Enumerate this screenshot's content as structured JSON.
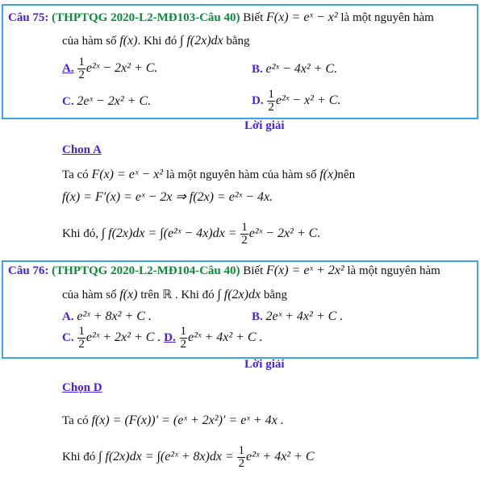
{
  "q75": {
    "label": "Câu 75:",
    "source": "(THPTQG 2020-L2-MĐ103-Câu 40)",
    "stem1_a": "Biết",
    "stem1_math": "F(x) = eˣ − x²",
    "stem1_b": "là một nguyên hàm",
    "stem2_a": "của hàm số",
    "stem2_math1": "f(x)",
    "stem2_b": ". Khi đó",
    "stem2_math2": "∫ f(2x)dx",
    "stem2_c": "bằng",
    "options": [
      {
        "label": "A.",
        "num": "1",
        "den": "2",
        "expr": "e²ˣ − 2x² + C."
      },
      {
        "label": "B.",
        "expr": "e²ˣ − 4x² + C."
      },
      {
        "label": "C.",
        "expr": "2eˣ − 2x² + C."
      },
      {
        "label": "D.",
        "num": "1",
        "den": "2",
        "expr": "e²ˣ − x² + C."
      }
    ],
    "solution_title": "Lời giải",
    "answer": "Chon A",
    "s1_a": "Ta có",
    "s1_math": "F(x) = eˣ − x²",
    "s1_b": "là một nguyên hàm của hàm số",
    "s1_math2": "f(x)",
    "s1_c": "nên",
    "s2_math": "f(x) = F′(x) = eˣ − 2x ⇒ f(2x) = e²ˣ − 4x.",
    "s3_a": "Khi đó,",
    "s3_math": "∫ f(2x)dx = ∫(e²ˣ − 4x)dx =",
    "s3_num": "1",
    "s3_den": "2",
    "s3_rest": "e²ˣ − 2x² + C."
  },
  "q76": {
    "label": "Câu 76:",
    "source": "(THPTQG 2020-L2-MĐ104-Câu 40)",
    "stem1_a": "Biết",
    "stem1_math": "F(x) = eˣ + 2x²",
    "stem1_b": "là một nguyên hàm",
    "stem2_a": "của hàm số",
    "stem2_math1": "f(x)",
    "stem2_b": "trên ℝ . Khi đó",
    "stem2_math2": "∫ f(2x)dx",
    "stem2_c": "bằng",
    "options": [
      {
        "label": "A.",
        "expr": "e²ˣ + 8x² + C ."
      },
      {
        "label": "B.",
        "expr": "2eˣ + 4x² + C ."
      },
      {
        "label": "C.",
        "num": "1",
        "den": "2",
        "expr": "e²ˣ + 2x² + C ."
      },
      {
        "label": "D.",
        "num": "1",
        "den": "2",
        "expr": "e²ˣ + 4x² + C ."
      }
    ],
    "solution_title": "Lời giải",
    "answer": "Chọn D",
    "s1_a": "Ta có",
    "s1_math": "f(x) = (F(x))′ = (eˣ + 2x²)′ = eˣ + 4x .",
    "s2_a": "Khi đó",
    "s2_math": "∫ f(2x)dx = ∫(e²ˣ + 8x)dx =",
    "s2_num": "1",
    "s2_den": "2",
    "s2_rest": "e²ˣ + 4x² + C"
  },
  "colors": {
    "border": "#3aa3ea",
    "label": "#4a1ee8",
    "source": "#0b8a3a"
  }
}
